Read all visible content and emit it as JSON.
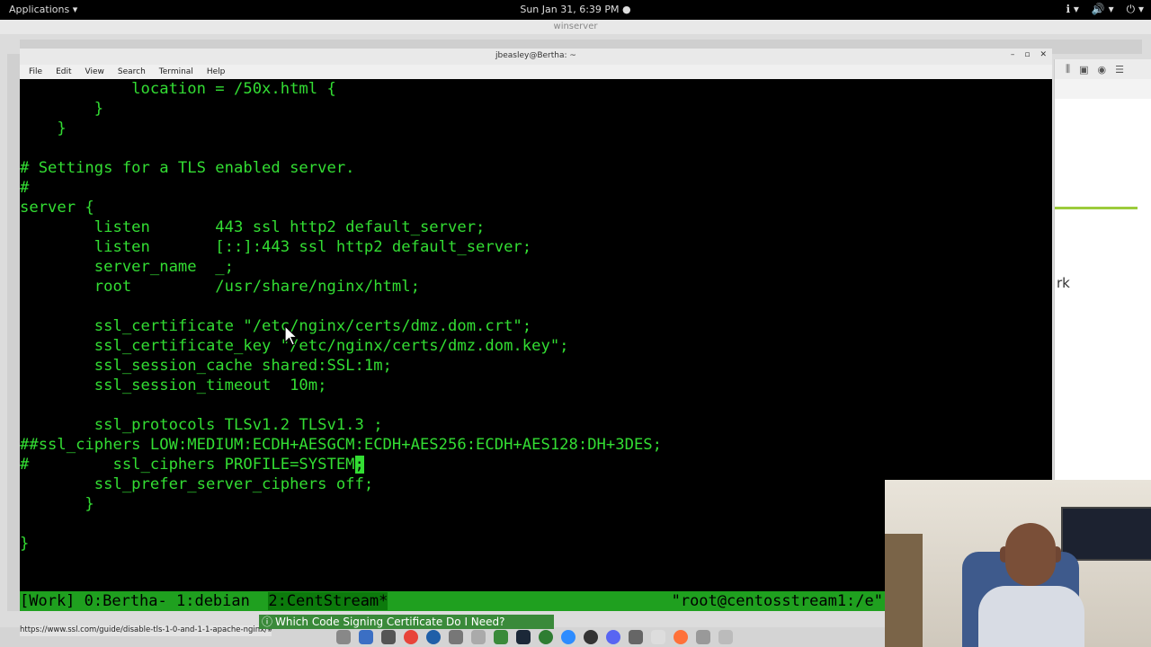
{
  "topbar": {
    "applications": "Applications ▾",
    "clock": "Sun Jan 31,  6:39 PM ●",
    "tray": [
      "ℹ ▾",
      "🔊 ▾",
      "⏻ ▾"
    ]
  },
  "outer_window": {
    "title": "winserver"
  },
  "terminal_window": {
    "title": "jbeasley@Bertha: ~",
    "menu": [
      "File",
      "Edit",
      "View",
      "Search",
      "Terminal",
      "Help"
    ],
    "lines": [
      "            location = /50x.html {",
      "        }",
      "    }",
      "",
      "# Settings for a TLS enabled server.",
      "#",
      "server {",
      "        listen       443 ssl http2 default_server;",
      "        listen       [::]:443 ssl http2 default_server;",
      "        server_name  _;",
      "        root         /usr/share/nginx/html;",
      "",
      "        ssl_certificate \"/etc/nginx/certs/dmz.dom.crt\";",
      "        ssl_certificate_key \"/etc/nginx/certs/dmz.dom.key\";",
      "        ssl_session_cache shared:SSL:1m;",
      "        ssl_session_timeout  10m;",
      "",
      "        ssl_protocols TLSv1.2 TLSv1.3 ;",
      "##ssl_ciphers LOW:MEDIUM:ECDH+AESGCM:ECDH+AES256:ECDH+AES128:DH+3DES;",
      "#         ssl_ciphers PROFILE=SYSTEM",
      "        ssl_prefer_server_ciphers off;",
      "       }",
      "",
      "}"
    ],
    "cursor_char": ";"
  },
  "tmux": {
    "left": "[Work] 0:Bertha- 1:debian  ",
    "active_window": "2:CentStream*",
    "right": "\"root@centosstream1:/e\""
  },
  "browser_fragment": "rk",
  "notification": "Which Code Signing Certificate Do I Need?",
  "status_url": "https://www.ssl.com/guide/disable-tls-1-0-and-1-1-apache-nginx/#",
  "colors": {
    "terminal_fg": "#33dd33",
    "terminal_bg": "#000000",
    "tmux_bar": "#1fa01f"
  }
}
